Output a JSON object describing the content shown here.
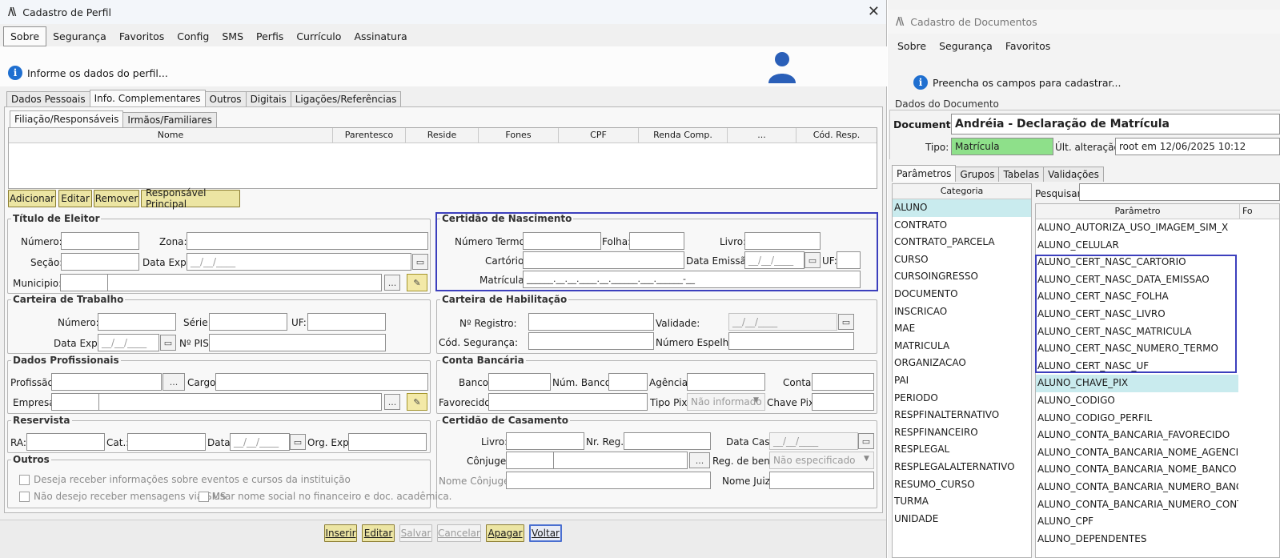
{
  "w1": {
    "title": "Cadastro de Perfil",
    "close": "✕",
    "menu": [
      "Sobre",
      "Segurança",
      "Favoritos",
      "Config",
      "SMS",
      "Perfis",
      "Currículo",
      "Assinatura"
    ],
    "info": "Informe os dados do perfil...",
    "tabs": [
      "Dados Pessoais",
      "Info. Complementares",
      "Outros",
      "Digitais",
      "Ligações/Referências"
    ],
    "subtabs": [
      "Filiação/Responsáveis",
      "Irmãos/Familiares"
    ],
    "grid_headers": [
      "Nome",
      "Parentesco",
      "Reside",
      "Fones",
      "CPF",
      "Renda Comp.",
      "...",
      "Cód. Resp."
    ],
    "grid_buttons": [
      "Adicionar",
      "Editar",
      "Remover",
      "Responsável Principal"
    ],
    "titulo": {
      "legend": "Título de Eleitor",
      "numero": "Número:",
      "zona": "Zona:",
      "secao": "Seção:",
      "data_exp": "Data Exp.:",
      "date_ph": "__/__/____",
      "municipio": "Municipio:",
      "ellipsis": "..."
    },
    "certidao": {
      "legend": "Certidão de Nascimento",
      "numero_termo": "Número Termo:",
      "folha": "Folha:",
      "livro": "Livro:",
      "cartorio": "Cartório:",
      "data_emissao": "Data Emissão:",
      "date_ph": "__/__/____",
      "uf": "UF:",
      "matricula": "Matrícula:",
      "mask": "______.__.__.____.__.______.___.______-__"
    },
    "carteira": {
      "legend": "Carteira de Trabalho",
      "numero": "Número:",
      "serie": "Série:",
      "uf": "UF:",
      "data_exp": "Data Exp.:",
      "date_ph": "__/__/____",
      "pis": "Nº PIS:"
    },
    "habilitacao": {
      "legend": "Carteira de Habilitação",
      "registro": "Nº Registro:",
      "validade": "Validade:",
      "date_ph": "__/__/____",
      "seguranca": "Cód. Segurança:",
      "espelho": "Número Espelho:"
    },
    "profissionais": {
      "legend": "Dados Profissionais",
      "profissao": "Profissão:",
      "cargo": "Cargo:",
      "empresa": "Empresa:",
      "ellipsis": "..."
    },
    "bancaria": {
      "legend": "Conta Bancária",
      "banco": "Banco:",
      "num_banco": "Núm. Banco:",
      "agencia": "Agência:",
      "conta": "Conta:",
      "favorecido": "Favorecido:",
      "tipo_pix": "Tipo Pix:",
      "tipo_pix_value": "Não informado",
      "chave_pix": "Chave Pix:"
    },
    "reservista": {
      "legend": "Reservista",
      "ra": "RA:",
      "cat": "Cat.:",
      "data": "Data:",
      "date_ph": "__/__/____",
      "org": "Org. Exp.:"
    },
    "casamento": {
      "legend": "Certidão de Casamento",
      "livro": "Livro:",
      "nr_reg": "Nr. Reg.:",
      "data_cas": "Data Cas.:",
      "date_ph": "__/__/____",
      "conjuge": "Cônjuge:",
      "ellipsis": "...",
      "reg_bens": "Reg. de bens:",
      "reg_bens_value": "Não especificado",
      "nome_conjuge": "Nome Cônjuge:",
      "nome_juiz": "Nome Juiz:"
    },
    "outros": {
      "legend": "Outros",
      "c1": "Deseja receber informações sobre eventos e cursos da instituição",
      "c2": "Não desejo receber mensagens via SMS",
      "c3": "Usar nome social no financeiro e doc. acadêmica."
    },
    "bottom": [
      "Inserir",
      "Editar",
      "Salvar",
      "Cancelar",
      "Apagar",
      "Voltar"
    ]
  },
  "w2": {
    "title": "Cadastro de Documentos",
    "menu": [
      "Sobre",
      "Segurança",
      "Favoritos"
    ],
    "info": "Preencha os campos para cadastrar...",
    "section": "Dados do Documento",
    "documento_label": "Documento:",
    "documento_value": "Andréia - Declaração de Matrícula",
    "tipo_label": "Tipo:",
    "tipo_value": "Matrícula",
    "ult_label": "Últ. alteração:",
    "ult_value": "root em 12/06/2025 10:12",
    "tabs": [
      "Parâmetros",
      "Grupos",
      "Tabelas",
      "Validações"
    ],
    "categoria_header": "Categoria",
    "categorias": [
      "ALUNO",
      "CONTRATO",
      "CONTRATO_PARCELA",
      "CURSO",
      "CURSOINGRESSO",
      "DOCUMENTO",
      "INSCRICAO",
      "MAE",
      "MATRICULA",
      "ORGANIZACAO",
      "PAI",
      "PERIODO",
      "RESPFINALTERNATIVO",
      "RESPFINANCEIRO",
      "RESPLEGAL",
      "RESPLEGALALTERNATIVO",
      "RESUMO_CURSO",
      "TURMA",
      "UNIDADE"
    ],
    "pesquisar": "Pesquisar:",
    "parametro_header": "Parâmetro",
    "col2_header": "Fo",
    "parametros": [
      "ALUNO_AUTORIZA_USO_IMAGEM_SIM_X",
      "ALUNO_CELULAR",
      "ALUNO_CERT_NASC_CARTORIO",
      "ALUNO_CERT_NASC_DATA_EMISSAO",
      "ALUNO_CERT_NASC_FOLHA",
      "ALUNO_CERT_NASC_LIVRO",
      "ALUNO_CERT_NASC_MATRICULA",
      "ALUNO_CERT_NASC_NUMERO_TERMO",
      "ALUNO_CERT_NASC_UF",
      "ALUNO_CHAVE_PIX",
      "ALUNO_CODIGO",
      "ALUNO_CODIGO_PERFIL",
      "ALUNO_CONTA_BANCARIA_FAVORECIDO",
      "ALUNO_CONTA_BANCARIA_NOME_AGENCIA",
      "ALUNO_CONTA_BANCARIA_NOME_BANCO",
      "ALUNO_CONTA_BANCARIA_NUMERO_BANCO",
      "ALUNO_CONTA_BANCARIA_NUMERO_CONTA",
      "ALUNO_CPF",
      "ALUNO_DEPENDENTES"
    ]
  },
  "colors": {
    "highlight": "#3c3fbd",
    "accent_blue": "#1f6fd0",
    "selected_row": "#c9ebee",
    "tipo_green": "#8ee08a",
    "button_yellow": "#ece5a3"
  }
}
